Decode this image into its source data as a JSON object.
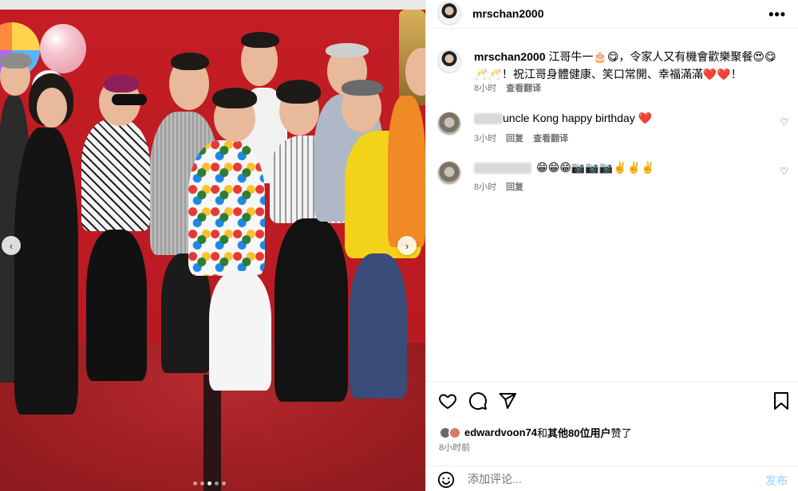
{
  "post": {
    "username": "mrschan2000",
    "more_label": "•••"
  },
  "caption": {
    "username": "mrschan2000",
    "text": " 江哥牛一🎂😋，令家人又有機會歡樂聚餐😍😋🥂🥂！祝江哥身體健康、笑口常開、幸福滿滿❤️❤️！",
    "time": "8小时",
    "translate": "查看翻译"
  },
  "comments": [
    {
      "text": "uncle Kong happy birthday ❤️",
      "time": "3小时",
      "reply": "回复",
      "translate": "查看翻译"
    },
    {
      "text": "😁😁😁📷📷📷✌️✌️✌️",
      "time": "8小时",
      "reply": "回复"
    }
  ],
  "likes": {
    "first_user": "edwardvoon74",
    "connector": "和",
    "others": "其他80位用户",
    "suffix": "赞了"
  },
  "time_ago": "8小时前",
  "comment_box": {
    "placeholder": "添加评论...",
    "post_label": "发布"
  },
  "carousel": {
    "total_dots": 5,
    "active_index": 2
  },
  "icons": {
    "like": "heart-outline-icon",
    "comment": "speech-bubble-icon",
    "share": "paper-plane-icon",
    "save": "bookmark-icon",
    "emoji": "smiley-icon",
    "prev": "chevron-left-icon",
    "next": "chevron-right-icon"
  }
}
